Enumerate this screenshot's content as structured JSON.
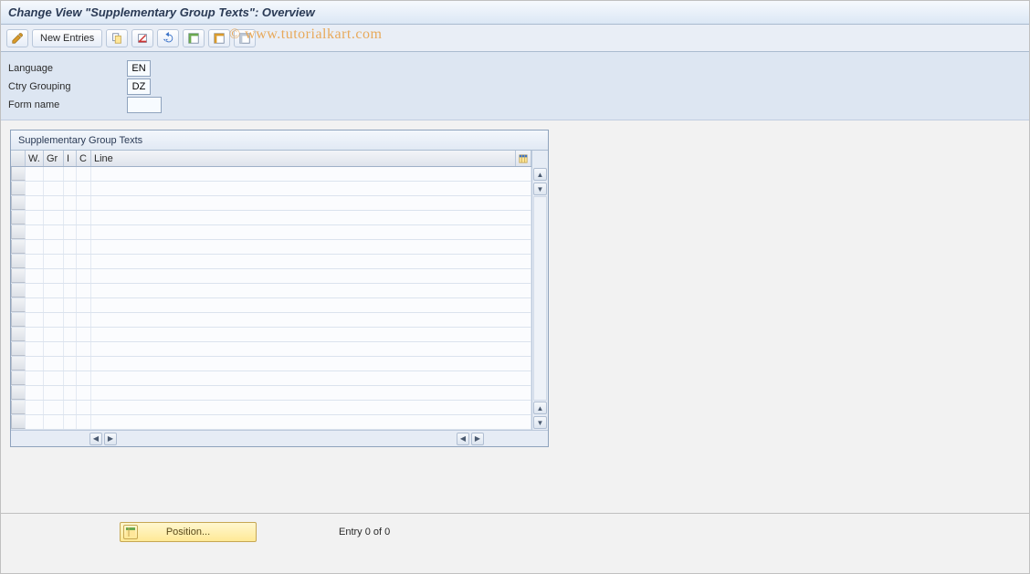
{
  "header": {
    "title": "Change View \"Supplementary Group Texts\": Overview"
  },
  "toolbar": {
    "new_entries_label": "New Entries",
    "icons": {
      "toggle": "toggle-pencil",
      "copy": "copy",
      "delete": "delete",
      "undo": "undo",
      "select_all": "select-all",
      "deselect_all": "deselect-all"
    }
  },
  "watermark": "© www.tutorialkart.com",
  "form": {
    "language_label": "Language",
    "language_value": "EN",
    "ctry_grouping_label": "Ctry Grouping",
    "ctry_grouping_value": "DZ",
    "form_name_label": "Form name",
    "form_name_value": ""
  },
  "table": {
    "title": "Supplementary Group Texts",
    "columns": {
      "w": "W.",
      "gr": "Gr",
      "i": "I",
      "c": "C",
      "line": "Line"
    },
    "rows": []
  },
  "footer": {
    "position_label": "Position...",
    "entry_text": "Entry 0 of 0"
  }
}
